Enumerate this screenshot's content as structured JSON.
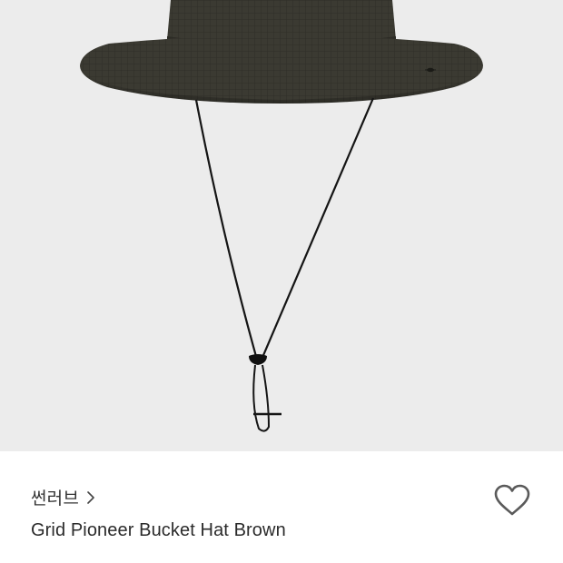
{
  "product": {
    "brand": "썬러브",
    "name": "Grid Pioneer Bucket Hat Brown"
  },
  "icons": {
    "brand_link": "chevron-right-icon",
    "wishlist": "heart-outline-icon"
  },
  "colors": {
    "image_background": "#ececec",
    "hat": "#3b3a32",
    "text_primary": "#2b2b2b",
    "icon_stroke": "#5a5a5a"
  }
}
